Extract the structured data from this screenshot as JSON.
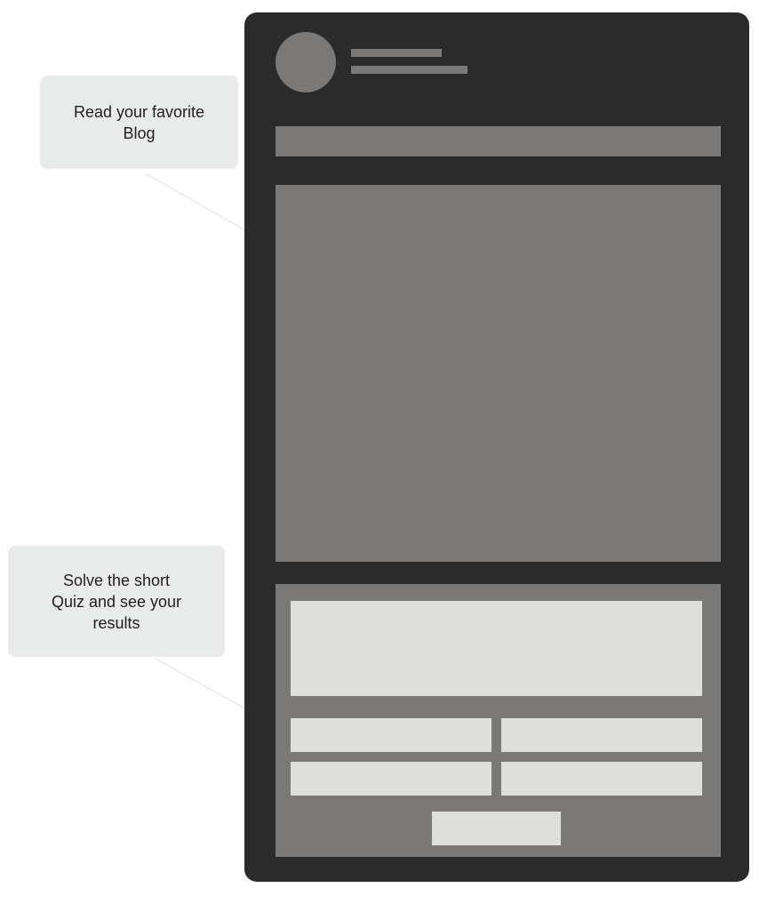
{
  "callouts": {
    "blog": "Read  your favorite\nBlog",
    "quiz": "Solve the short\nQuiz and see your\nresults"
  },
  "colors": {
    "frame": "#2b2b2b",
    "placeholder": "#7a7977",
    "quiz_placeholder": "#dededd",
    "callout_background": "#e9eaea",
    "arrow": "#e8e8e8"
  }
}
